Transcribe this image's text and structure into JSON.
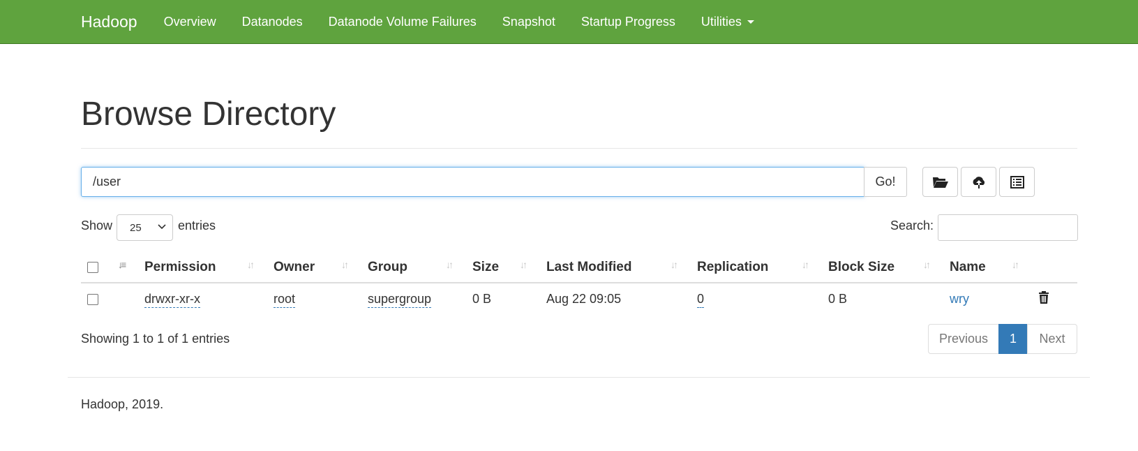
{
  "navbar": {
    "brand": "Hadoop",
    "items": [
      "Overview",
      "Datanodes",
      "Datanode Volume Failures",
      "Snapshot",
      "Startup Progress",
      "Utilities"
    ]
  },
  "page": {
    "title": "Browse Directory"
  },
  "path_bar": {
    "value": "/user",
    "go_label": "Go!"
  },
  "toolbar_icons": [
    "folder-open-icon",
    "cloud-upload-icon",
    "list-alt-icon"
  ],
  "length": {
    "show_label": "Show",
    "selected": "25",
    "entries_label": "entries"
  },
  "search": {
    "label": "Search:",
    "value": ""
  },
  "table": {
    "headers": [
      "Permission",
      "Owner",
      "Group",
      "Size",
      "Last Modified",
      "Replication",
      "Block Size",
      "Name"
    ],
    "rows": [
      {
        "permission": "drwxr-xr-x",
        "owner": "root",
        "group": "supergroup",
        "size": "0 B",
        "last_modified": "Aug 22 09:05",
        "replication": "0",
        "block_size": "0 B",
        "name": "wry"
      }
    ]
  },
  "info": "Showing 1 to 1 of 1 entries",
  "pagination": {
    "previous": "Previous",
    "current": "1",
    "next": "Next"
  },
  "footer": "Hadoop, 2019.",
  "colors": {
    "navbar": "#5fa33e",
    "link": "#337ab7",
    "active_page": "#337ab7"
  }
}
